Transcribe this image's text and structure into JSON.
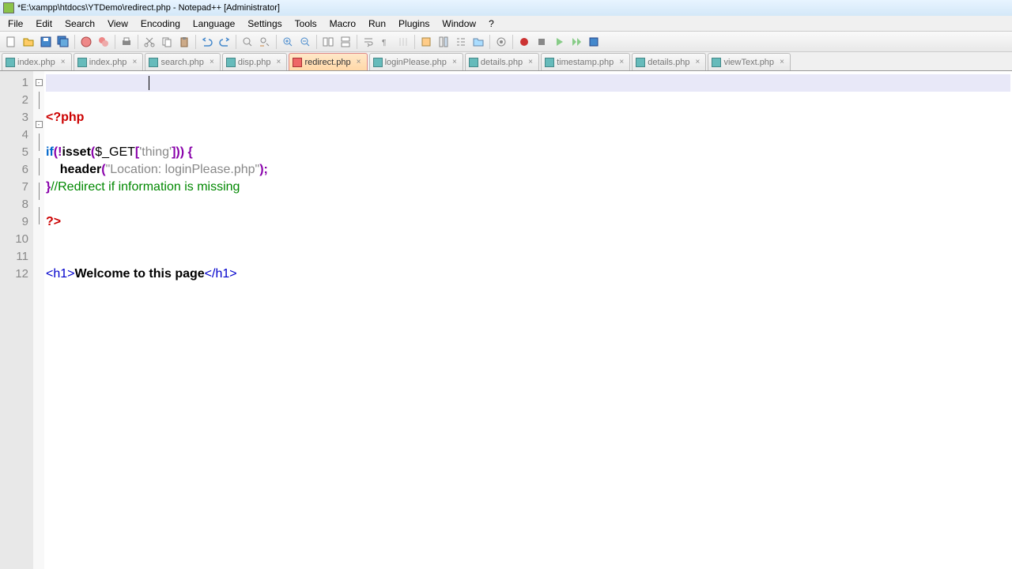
{
  "title": "*E:\\xampp\\htdocs\\YTDemo\\redirect.php - Notepad++ [Administrator]",
  "menu": [
    "File",
    "Edit",
    "Search",
    "View",
    "Encoding",
    "Language",
    "Settings",
    "Tools",
    "Macro",
    "Run",
    "Plugins",
    "Window",
    "?"
  ],
  "tabs": [
    {
      "label": "index.php",
      "active": false
    },
    {
      "label": "index.php",
      "active": false
    },
    {
      "label": "search.php",
      "active": false
    },
    {
      "label": "disp.php",
      "active": false
    },
    {
      "label": "redirect.php",
      "active": true
    },
    {
      "label": "loginPlease.php",
      "active": false
    },
    {
      "label": "details.php",
      "active": false
    },
    {
      "label": "timestamp.php",
      "active": false
    },
    {
      "label": "details.php",
      "active": false
    },
    {
      "label": "viewText.php",
      "active": false
    }
  ],
  "lines": {
    "l1": "",
    "l2": "",
    "l3_open": "<?php",
    "l4": "",
    "l5_if": "if",
    "l5_op1": "(!",
    "l5_isset": "isset",
    "l5_op2": "(",
    "l5_get": "$_GET",
    "l5_op3": "[",
    "l5_str": "'thing'",
    "l5_op4": "])) {",
    "l6_indent": "    ",
    "l6_header": "header",
    "l6_op1": "(",
    "l6_str": "\"Location: loginPlease.php\"",
    "l6_op2": ");",
    "l7_brace": "}",
    "l7_comment": "//Redirect if information is missing",
    "l8": "",
    "l9_close": "?>",
    "l10": "",
    "l11": "",
    "l12_t1": "<h1>",
    "l12_txt": "Welcome to this page",
    "l12_t2": "</h1>"
  },
  "line_numbers": [
    "1",
    "2",
    "3",
    "4",
    "5",
    "6",
    "7",
    "8",
    "9",
    "10",
    "11",
    "12"
  ]
}
